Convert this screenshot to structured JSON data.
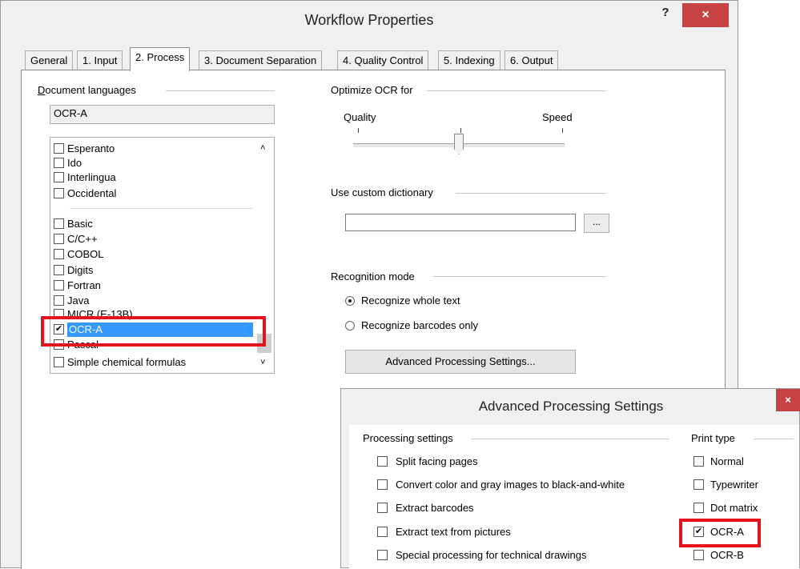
{
  "window": {
    "title": "Workflow Properties",
    "help_label": "?",
    "close_label": "×"
  },
  "tabs": [
    "General",
    "1. Input",
    "2. Process",
    "3. Document Separation",
    "4. Quality Control",
    "5. Indexing",
    "6. Output"
  ],
  "active_tab": "2. Process",
  "document_languages": {
    "label": "Document languages",
    "current_value": "OCR-A",
    "items": [
      {
        "label": "Esperanto",
        "checked": false
      },
      {
        "label": "Ido",
        "checked": false
      },
      {
        "label": "Interlingua",
        "checked": false
      },
      {
        "label": "Occidental",
        "checked": false
      },
      {
        "label": "Basic",
        "checked": false
      },
      {
        "label": "C/C++",
        "checked": false
      },
      {
        "label": "COBOL",
        "checked": false
      },
      {
        "label": "Digits",
        "checked": false
      },
      {
        "label": "Fortran",
        "checked": false
      },
      {
        "label": "Java",
        "checked": false
      },
      {
        "label": "MICR (E-13B)",
        "checked": false
      },
      {
        "label": "OCR-A",
        "checked": true,
        "selected": true
      },
      {
        "label": "Pascal",
        "checked": false
      },
      {
        "label": "Simple chemical formulas",
        "checked": false
      }
    ]
  },
  "optimize": {
    "label": "Optimize OCR for",
    "left_label": "Quality",
    "right_label": "Speed",
    "slider_position_fraction": 0.5
  },
  "custom_dictionary": {
    "label": "Use custom dictionary",
    "value": "",
    "browse_label": "..."
  },
  "recognition_mode": {
    "label": "Recognition mode",
    "options": [
      {
        "label": "Recognize whole text",
        "selected": true
      },
      {
        "label": "Recognize barcodes only",
        "selected": false
      }
    ]
  },
  "advanced_button_label": "Advanced Processing Settings...",
  "advanced_dialog": {
    "title": "Advanced Processing Settings",
    "close_label": "×",
    "processing_label": "Processing settings",
    "processing_options": [
      {
        "label": "Split facing pages",
        "checked": false
      },
      {
        "label": "Convert color and gray images to black-and-white",
        "checked": false
      },
      {
        "label": "Extract barcodes",
        "checked": false
      },
      {
        "label": "Extract text from pictures",
        "checked": false
      },
      {
        "label": "Special processing for technical drawings",
        "checked": false
      }
    ],
    "print_type_label": "Print type",
    "print_types": [
      {
        "label": "Normal",
        "checked": false
      },
      {
        "label": "Typewriter",
        "checked": false
      },
      {
        "label": "Dot matrix",
        "checked": false
      },
      {
        "label": "OCR-A",
        "checked": true
      },
      {
        "label": "OCR-B",
        "checked": false
      }
    ]
  },
  "colors": {
    "highlight_box": "#e3141e",
    "selection": "#3399ff",
    "close_button": "#c74343"
  }
}
